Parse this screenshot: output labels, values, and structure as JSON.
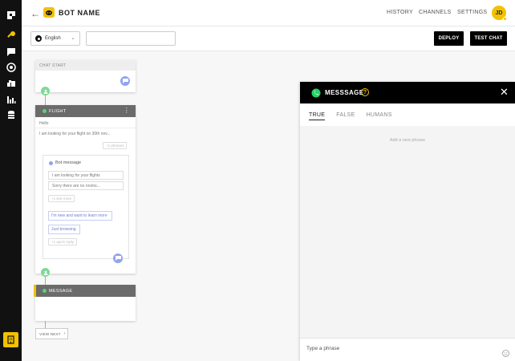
{
  "header": {
    "bot_name": "BOT NAME",
    "nav": [
      "HISTORY",
      "CHANNELS",
      "SETTINGS"
    ],
    "avatar_initials": "JD"
  },
  "toolbar": {
    "language": "English",
    "search_value": "",
    "deploy_label": "DEPLOY",
    "test_chat_label": "TEST CHAT"
  },
  "canvas": {
    "chat_start_label": "CHAT START",
    "flight": {
      "title": "FLIGHT",
      "greeting": "Hello",
      "phrase": "I am looking for your flight on 30th nov...",
      "add_phrase_pill": "+1 phrases",
      "bot_message": {
        "title": "Bot message",
        "lines": [
          "I am looking for your flights",
          "Sorry there are no rooms..."
        ],
        "add_text_pill": "+1 text more",
        "options": [
          "I'm new and want to learn more",
          "Just browsing"
        ],
        "add_button_pill": "+1 quick reply"
      }
    },
    "message_node_title": "MESSAGE",
    "view_next_label": "VIEW NEXT"
  },
  "panel": {
    "title": "MESSSAGE",
    "tabs": [
      "TRUE",
      "FALSE",
      "HUMANS"
    ],
    "active_tab": "TRUE",
    "empty_hint": "Add a new phrase",
    "input_placeholder": "Type a phrase"
  },
  "colors": {
    "accent_yellow": "#f2c200",
    "node_header": "#6b6b6b",
    "success_green": "#59d27a",
    "bubble_blue": "#8fa4ef"
  }
}
